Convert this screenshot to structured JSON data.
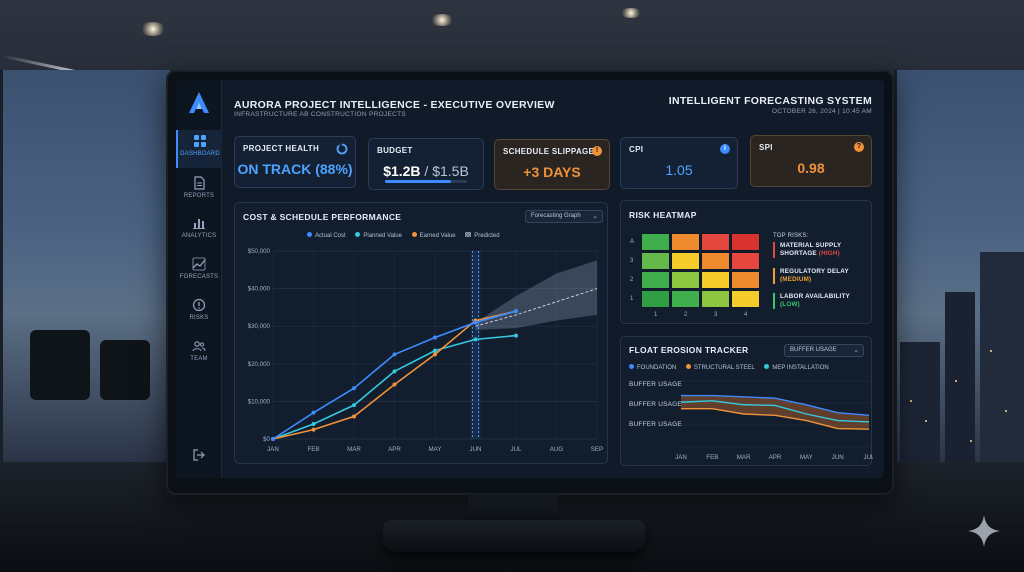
{
  "app": {
    "title": "AURORA PROJECT INTELLIGENCE - EXECUTIVE OVERVIEW",
    "subtitle": "INFRASTRUCTURE AB CONSTRUCTION PROJECTS",
    "system_title": "INTELLIGENT FORECASTING SYSTEM",
    "date": "OCTOBER 26, 2024 | 10:45 AM"
  },
  "sidebar": {
    "items": [
      {
        "label": "DASHBOARD",
        "icon": "dashboard-icon",
        "active": true
      },
      {
        "label": "REPORTS",
        "icon": "document-icon"
      },
      {
        "label": "ANALYTICS",
        "icon": "bar-chart-icon"
      },
      {
        "label": "FORECASTS",
        "icon": "trend-icon"
      },
      {
        "label": "RISKS",
        "icon": "alert-icon"
      },
      {
        "label": "TEAM",
        "icon": "people-icon"
      }
    ],
    "logout_icon": "logout-icon"
  },
  "kpis": {
    "health": {
      "label": "PROJECT HEALTH",
      "value": "ON TRACK (88%)",
      "progress": 0.88
    },
    "budget": {
      "label": "BUDGET",
      "value": "$1.2B",
      "total": " / $1.5B",
      "spent_fraction": 0.8
    },
    "slippage": {
      "label": "SCHEDULE SLIPPAGE",
      "value": "+3 DAYS"
    },
    "cpi": {
      "label": "CPI",
      "value": "1.05"
    },
    "spi": {
      "label": "SPI",
      "value": "0.98"
    }
  },
  "colors": {
    "accent": "#3d8bff",
    "actual_cost": "#3d8bff",
    "planned_value": "#35c9e0",
    "earned_value": "#f0923a",
    "warning": "#f0923a",
    "high": "#e04a3f",
    "medium": "#f0a030",
    "low": "#3ec46d"
  },
  "cost_panel": {
    "title": "COST & SCHEDULE PERFORMANCE",
    "dropdown": "Forecasting Graph",
    "legend": [
      "Actual Cost",
      "Planned Value",
      "Earned Value",
      "Predicted"
    ]
  },
  "chart_data": {
    "type": "line",
    "categories": [
      "JAN",
      "FEB",
      "MAR",
      "APR",
      "MAY",
      "JUN",
      "JUL",
      "AUG",
      "SEP"
    ],
    "yticks": [
      "$0",
      "$10,000",
      "$20,000",
      "$30,000",
      "$40,000",
      "$50,000"
    ],
    "ylim": [
      0,
      50000
    ],
    "series": [
      {
        "name": "Actual Cost",
        "values": [
          0,
          7000,
          13500,
          22500,
          27000,
          31000,
          34000
        ]
      },
      {
        "name": "Planned Value",
        "values": [
          0,
          4000,
          9000,
          18000,
          23500,
          26500,
          27500
        ]
      },
      {
        "name": "Earned Value",
        "values": [
          0,
          2500,
          6000,
          14500,
          22500,
          31500,
          34000
        ]
      },
      {
        "name": "Predicted",
        "values": [
          null,
          null,
          null,
          null,
          null,
          30000,
          33000,
          36500,
          40000
        ],
        "upper": [
          null,
          null,
          null,
          null,
          null,
          31000,
          38000,
          44000,
          47500
        ],
        "lower": [
          null,
          null,
          null,
          null,
          null,
          29000,
          29500,
          31500,
          33000
        ]
      }
    ],
    "current_marker": "JUN"
  },
  "heatmap": {
    "title": "RISK HEATMAP",
    "y_labels": [
      "A",
      "3",
      "2",
      "1"
    ],
    "x_labels": [
      "1",
      "2",
      "3",
      "4"
    ],
    "grid": [
      [
        "#3fae4c",
        "#f08a2e",
        "#e5473e",
        "#d8332e"
      ],
      [
        "#65b84a",
        "#f5cc2a",
        "#f08a2e",
        "#e5473e"
      ],
      [
        "#3fae4c",
        "#8cc640",
        "#f5cc2a",
        "#f08a2e"
      ],
      [
        "#2f9e44",
        "#3fae4c",
        "#8cc640",
        "#f5cc2a"
      ]
    ],
    "top_risks_label": "TOP RISKS:",
    "risks": [
      {
        "name": "MATERIAL SUPPLY SHORTAGE",
        "level": "(HIGH)",
        "color": "#e04a3f"
      },
      {
        "name": "REGULATORY DELAY",
        "level": "(MEDIUM)",
        "color": "#f0a030"
      },
      {
        "name": "LABOR AVAILABILITY",
        "level": "(LOW)",
        "color": "#3ec46d"
      }
    ]
  },
  "float_panel": {
    "title": "FLOAT EROSION TRACKER",
    "dropdown": "BUFFER USAGE",
    "legend": [
      "FOUNDATION",
      "STRUCTURAL STEEL",
      "MEP INSTALLATION"
    ],
    "row_labels": [
      "BUFFER USAGE",
      "BUFFER USAGE",
      "BUFFER USAGE"
    ],
    "categories": [
      "JAN",
      "FEB",
      "MAR",
      "APR",
      "MAY",
      "JUN",
      "JUL"
    ],
    "series": [
      {
        "name": "FOUNDATION",
        "values": [
          0.78,
          0.78,
          0.76,
          0.74,
          0.64,
          0.52,
          0.48
        ]
      },
      {
        "name": "STRUCTURAL STEEL",
        "values": [
          0.58,
          0.58,
          0.5,
          0.48,
          0.4,
          0.28,
          0.27
        ]
      },
      {
        "name": "MEP INSTALLATION",
        "values": [
          0.68,
          0.7,
          0.64,
          0.63,
          0.5,
          0.4,
          0.38
        ]
      }
    ]
  }
}
